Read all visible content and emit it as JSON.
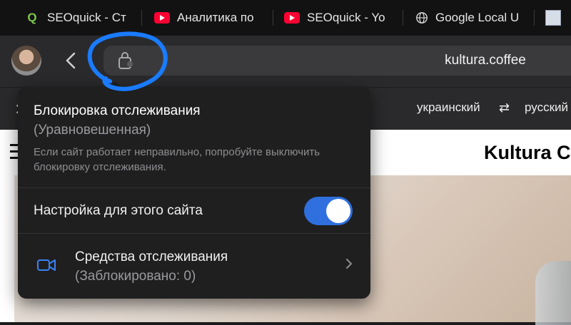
{
  "tabs": [
    {
      "favicon": "seoquick-icon",
      "title": "SEOquick - Ст"
    },
    {
      "favicon": "youtube-icon",
      "title": "Аналитика по"
    },
    {
      "favicon": "youtube-icon",
      "title": "SEOquick - Yo"
    },
    {
      "favicon": "globe-icon",
      "title": "Google Local U"
    },
    {
      "favicon": "image-favicon-icon",
      "title": ""
    }
  ],
  "toolbar": {
    "url": "kultura.coffee"
  },
  "translate": {
    "close_glyph": "✕",
    "source_lang": "украинский",
    "swap_glyph": "⇄",
    "target_lang": "русский"
  },
  "page": {
    "site_title": "Kultura C"
  },
  "popover": {
    "title": "Блокировка отслеживания",
    "subtitle": "(Уравновешенная)",
    "description": "Если сайт работает неправильно, попробуйте выключить блокировку отслеживания.",
    "toggle_label": "Настройка для этого сайта",
    "toggle_on": true,
    "trackers_label": "Средства отслеживания",
    "trackers_count": "(Заблокировано: 0)"
  },
  "colors": {
    "accent": "#2f6fde",
    "annotation": "#1a7bff"
  }
}
